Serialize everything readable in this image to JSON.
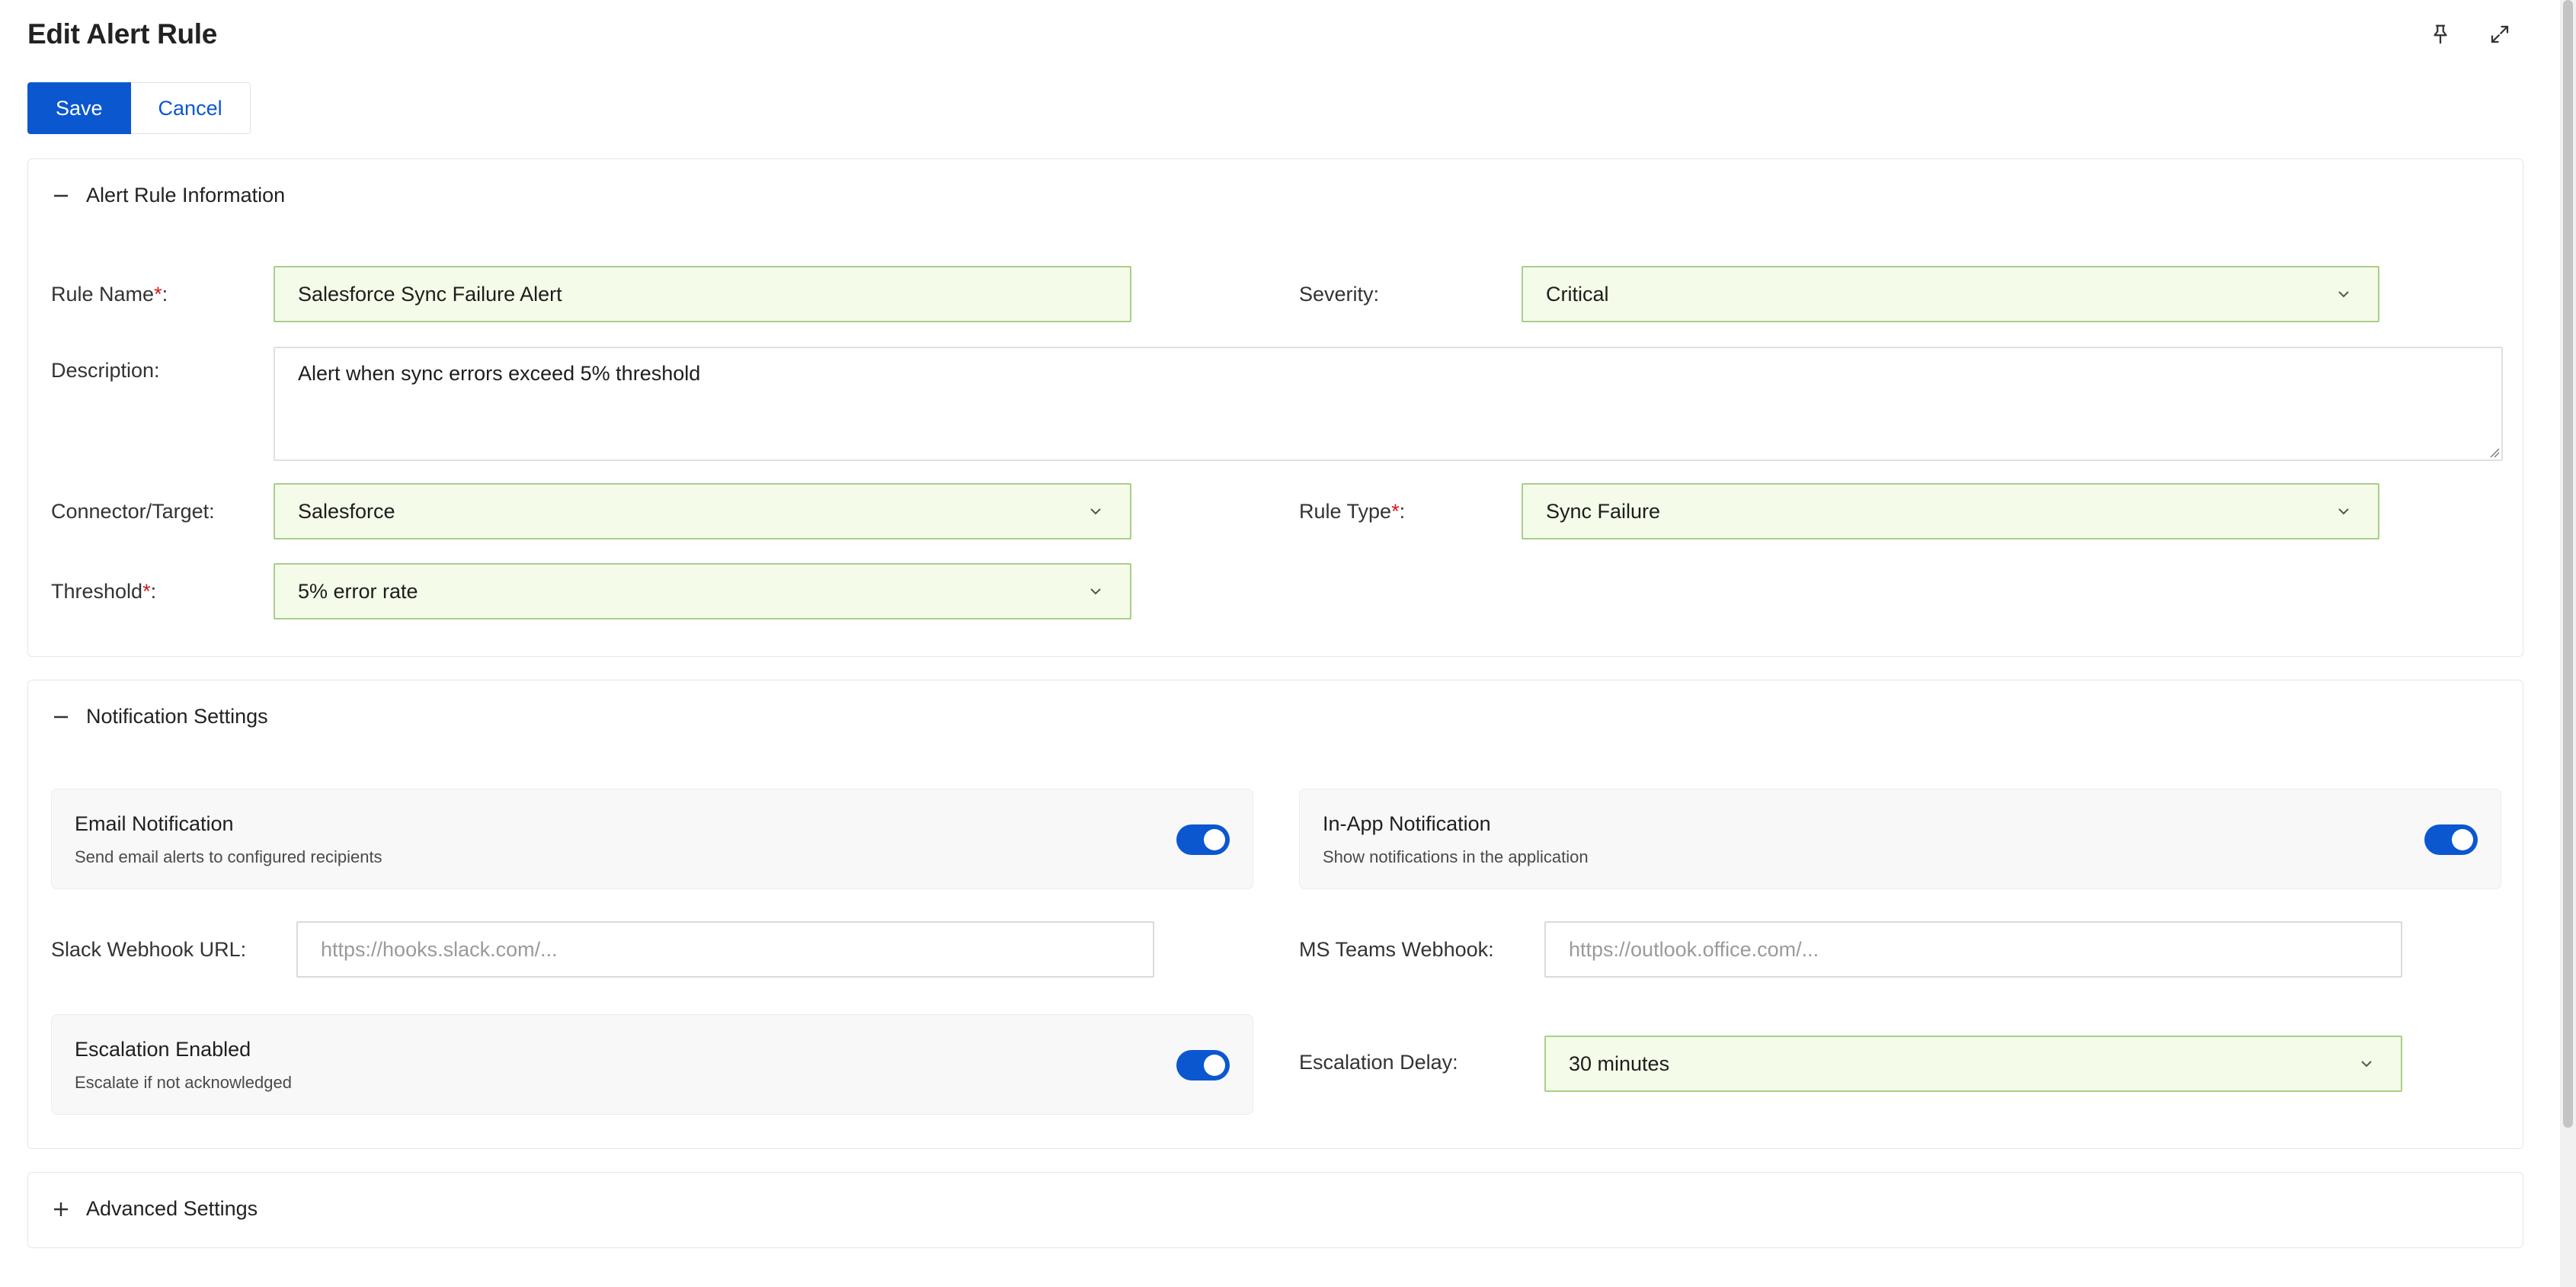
{
  "page": {
    "title": "Edit Alert Rule"
  },
  "toolbar": {
    "save_label": "Save",
    "cancel_label": "Cancel"
  },
  "sections": {
    "info": {
      "title": "Alert Rule Information"
    },
    "notifications": {
      "title": "Notification Settings"
    },
    "advanced": {
      "title": "Advanced Settings"
    }
  },
  "fields": {
    "rule_name": {
      "label": "Rule Name",
      "required": "*",
      "suffix": ":",
      "value": "Salesforce Sync Failure Alert"
    },
    "severity": {
      "label": "Severity:",
      "value": "Critical"
    },
    "description": {
      "label": "Description:",
      "value": "Alert when sync errors exceed 5% threshold"
    },
    "connector": {
      "label": "Connector/Target:",
      "value": "Salesforce"
    },
    "rule_type": {
      "label": "Rule Type",
      "required": "*",
      "suffix": ":",
      "value": "Sync Failure"
    },
    "threshold": {
      "label": "Threshold",
      "required": "*",
      "suffix": ":",
      "value": "5% error rate"
    },
    "slack": {
      "label": "Slack Webhook URL:",
      "placeholder": "https://hooks.slack.com/..."
    },
    "teams": {
      "label": "MS Teams Webhook:",
      "placeholder": "https://outlook.office.com/..."
    },
    "escalation_delay": {
      "label": "Escalation Delay:",
      "value": "30 minutes"
    }
  },
  "toggles": {
    "email": {
      "title": "Email Notification",
      "subtitle": "Send email alerts to configured recipients",
      "enabled": true
    },
    "in_app": {
      "title": "In-App Notification",
      "subtitle": "Show notifications in the application",
      "enabled": true
    },
    "escalation": {
      "title": "Escalation Enabled",
      "subtitle": "Escalate if not acknowledged",
      "enabled": true
    }
  },
  "icons": {
    "pin": "pin-icon",
    "expand": "expand-icon",
    "collapse": "minus-icon",
    "expand_section": "plus-icon",
    "dropdown": "chevron-down-icon"
  },
  "colors": {
    "primary": "#0a57d0",
    "field_border": "#a9cf8a",
    "field_bg": "#f4fbe8",
    "required": "#d11a1a"
  }
}
